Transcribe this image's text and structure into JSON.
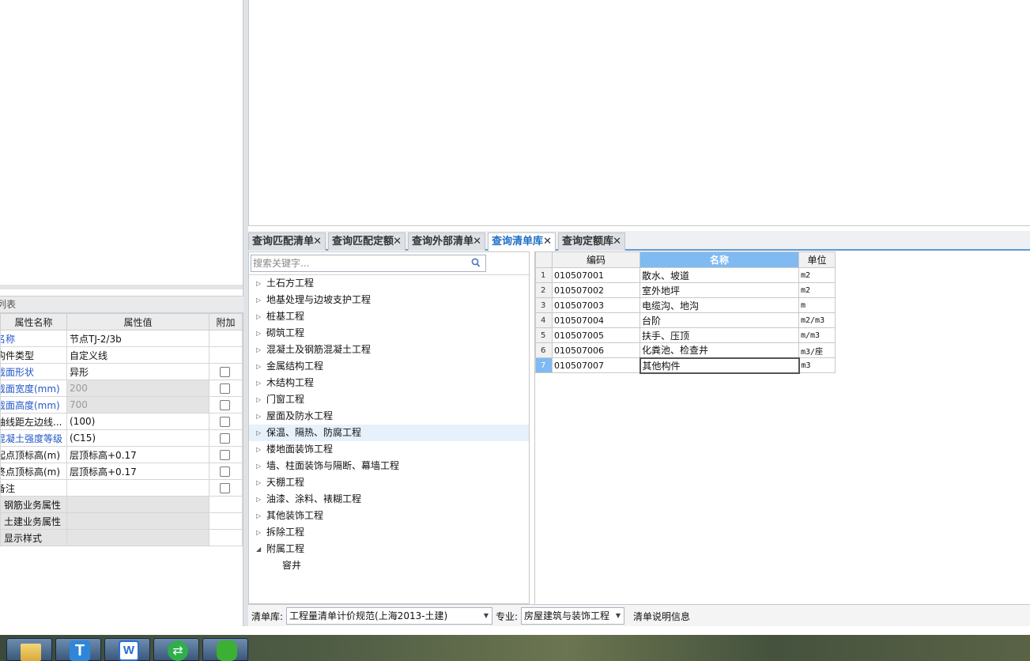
{
  "props": {
    "title": "列表",
    "headers": [
      "属性名称",
      "属性值",
      "附加"
    ],
    "rows": [
      {
        "name": "名称",
        "value": "节点TJ-2/3b",
        "blue": true,
        "gray": false,
        "check": false,
        "shade": false
      },
      {
        "name": "构件类型",
        "value": "自定义线",
        "blue": false,
        "gray": false,
        "check": false,
        "shade": false
      },
      {
        "name": "截面形状",
        "value": "异形",
        "blue": true,
        "gray": false,
        "check": true,
        "shade": false
      },
      {
        "name": "截面宽度(mm)",
        "value": "200",
        "blue": true,
        "gray": true,
        "check": true,
        "shade": true
      },
      {
        "name": "截面高度(mm)",
        "value": "700",
        "blue": true,
        "gray": true,
        "check": true,
        "shade": true
      },
      {
        "name": "轴线距左边线...",
        "value": "(100)",
        "blue": false,
        "gray": false,
        "check": true,
        "shade": false
      },
      {
        "name": "混凝土强度等级",
        "value": "(C15)",
        "blue": true,
        "gray": false,
        "check": true,
        "shade": false
      },
      {
        "name": "起点顶标高(m)",
        "value": "层顶标高+0.17",
        "blue": false,
        "gray": false,
        "check": true,
        "shade": false
      },
      {
        "name": "终点顶标高(m)",
        "value": "层顶标高+0.17",
        "blue": false,
        "gray": false,
        "check": true,
        "shade": false
      },
      {
        "name": "备注",
        "value": "",
        "blue": false,
        "gray": false,
        "check": true,
        "shade": false
      },
      {
        "name": "钢筋业务属性",
        "value": "",
        "blue": false,
        "gray": false,
        "check": false,
        "shade": true,
        "group": true
      },
      {
        "name": "土建业务属性",
        "value": "",
        "blue": false,
        "gray": false,
        "check": false,
        "shade": true,
        "group": true
      },
      {
        "name": "显示样式",
        "value": "",
        "blue": false,
        "gray": false,
        "check": false,
        "shade": true,
        "group": true
      }
    ]
  },
  "tabs": [
    {
      "label": "查询匹配清单",
      "active": false
    },
    {
      "label": "查询匹配定额",
      "active": false
    },
    {
      "label": "查询外部清单",
      "active": false
    },
    {
      "label": "查询清单库",
      "active": true
    },
    {
      "label": "查询定额库",
      "active": false
    }
  ],
  "search": {
    "placeholder": "搜索关键字..."
  },
  "tree": {
    "nodes": [
      {
        "label": "土石方工程",
        "expanded": false
      },
      {
        "label": "地基处理与边坡支护工程",
        "expanded": false
      },
      {
        "label": "桩基工程",
        "expanded": false
      },
      {
        "label": "砌筑工程",
        "expanded": false
      },
      {
        "label": "混凝土及钢筋混凝土工程",
        "expanded": false
      },
      {
        "label": "金属结构工程",
        "expanded": false
      },
      {
        "label": "木结构工程",
        "expanded": false
      },
      {
        "label": "门窗工程",
        "expanded": false
      },
      {
        "label": "屋面及防水工程",
        "expanded": false
      },
      {
        "label": "保温、隔热、防腐工程",
        "expanded": false,
        "highlight": true
      },
      {
        "label": "楼地面装饰工程",
        "expanded": false
      },
      {
        "label": "墙、柱面装饰与隔断、幕墙工程",
        "expanded": false
      },
      {
        "label": "天棚工程",
        "expanded": false
      },
      {
        "label": "油漆、涂料、裱糊工程",
        "expanded": false
      },
      {
        "label": "其他装饰工程",
        "expanded": false
      },
      {
        "label": "拆除工程",
        "expanded": false
      },
      {
        "label": "附属工程",
        "expanded": true
      }
    ],
    "child": "窨井"
  },
  "grid": {
    "headers": [
      "编码",
      "名称",
      "单位"
    ],
    "rows": [
      {
        "n": "1",
        "code": "010507001",
        "name": "散水、坡道",
        "unit": "m2"
      },
      {
        "n": "2",
        "code": "010507002",
        "name": "室外地坪",
        "unit": "m2"
      },
      {
        "n": "3",
        "code": "010507003",
        "name": "电缆沟、地沟",
        "unit": "m"
      },
      {
        "n": "4",
        "code": "010507004",
        "name": "台阶",
        "unit": "m2/m3"
      },
      {
        "n": "5",
        "code": "010507005",
        "name": "扶手、压顶",
        "unit": "m/m3"
      },
      {
        "n": "6",
        "code": "010507006",
        "name": "化粪池、检查井",
        "unit": "m3/座"
      },
      {
        "n": "7",
        "code": "010507007",
        "name": "其他构件",
        "unit": "m3"
      }
    ]
  },
  "status": {
    "lib_label": "清单库:",
    "lib_value": "工程量清单计价规范(上海2013-土建)",
    "spec_label": "专业:",
    "spec_value": "房屋建筑与装饰工程",
    "info": "清单说明信息"
  },
  "colors": {
    "accent": "#5b9bd5",
    "selected": "#7fbaf2",
    "link_text": "#2357c8"
  },
  "taskbar": {
    "icons": [
      "explorer-icon",
      "glodon-t-icon",
      "wps-icon",
      "sync-icon",
      "wechat-icon"
    ]
  }
}
